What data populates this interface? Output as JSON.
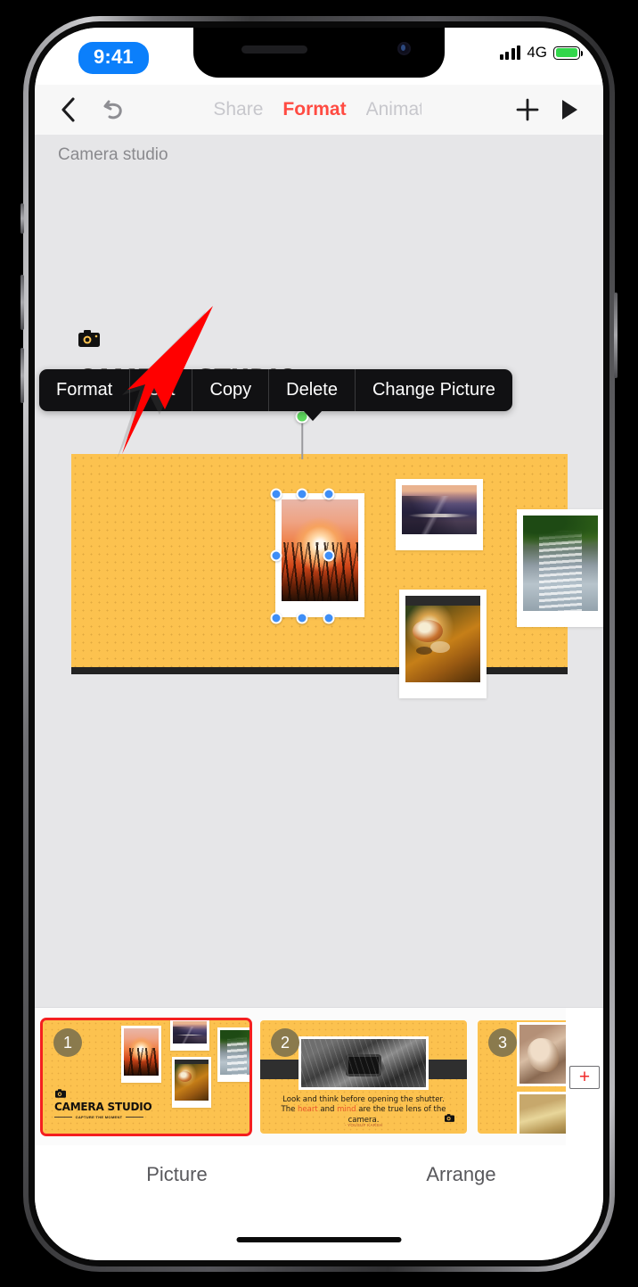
{
  "status_bar": {
    "time": "9:41",
    "network": "4G",
    "battery_icon": "battery-full-icon",
    "signal_icon": "signal-bars-icon"
  },
  "toolbar": {
    "back_icon": "chevron-left-icon",
    "undo_icon": "undo-arrow-icon",
    "tabs": [
      {
        "label": "Share",
        "active": false
      },
      {
        "label": "Format",
        "active": true
      },
      {
        "label": "Animat",
        "active": false
      }
    ],
    "add_icon": "plus-icon",
    "play_icon": "play-triangle-icon",
    "accent_color": "#ff4b42"
  },
  "canvas": {
    "document_title": "Camera studio",
    "background_color": "#e6e6e8"
  },
  "context_menu": {
    "items": [
      {
        "label": "Format"
      },
      {
        "label": "Cut"
      },
      {
        "label": "Copy"
      },
      {
        "label": "Delete"
      },
      {
        "label": "Change Picture"
      }
    ],
    "background_color": "#111113"
  },
  "annotation": {
    "arrow_color": "#ff0000",
    "arrow_icon": "red-pointer-arrow-icon",
    "points_to": "Format"
  },
  "selection": {
    "handle_color": "#3e8ef7",
    "rotate_handle_color": "#5ed95e",
    "selected_object": "sunset-photo"
  },
  "slide": {
    "background_color": "#fcc24f",
    "title": "CAMERA STUDIO",
    "subtitle": "CAPTURE THE MOMENT",
    "camera_icon": "camera-icon",
    "photos": [
      {
        "name": "sunset-photo",
        "selected": true
      },
      {
        "name": "mountain-photo",
        "selected": false
      },
      {
        "name": "spider-photo",
        "selected": false
      },
      {
        "name": "waterfall-photo",
        "selected": false
      }
    ]
  },
  "thumbnails": {
    "slides": [
      {
        "number": "1",
        "selected": true,
        "title": "CAMERA STUDIO",
        "subtitle": "CAPTURE THE MOMENT"
      },
      {
        "number": "2",
        "selected": false,
        "quote_line_1": "Look and think before opening the",
        "quote_line_2_a": "shutter. The ",
        "quote_highlight_1": "heart",
        "quote_line_2_b": " and ",
        "quote_highlight_2": "mind",
        "quote_line_2_c": " are the true",
        "quote_line_3": "lens of the camera.",
        "author": "- YOUSUF KARSH"
      },
      {
        "number": "3",
        "selected": false
      }
    ],
    "add_slide_label": "+",
    "selected_outline_color": "#f41f1f"
  },
  "bottom_bar": {
    "tabs": [
      {
        "label": "Picture"
      },
      {
        "label": "Arrange"
      }
    ]
  }
}
